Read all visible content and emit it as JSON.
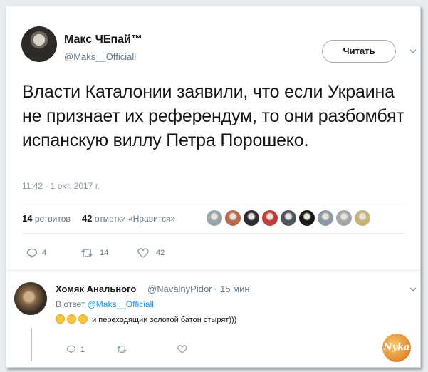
{
  "tweet": {
    "author": {
      "name": "Макс ЧЕпай™",
      "handle": "@Maks__Officiall"
    },
    "follow_label": "Читать",
    "text": "Власти Каталонии заявили, что если Украина не признает их референдум, то они разбомбят испанскую виллу Петра Порошеко.",
    "timestamp": "11:42 - 1 окт. 2017 г.",
    "stats": {
      "retweets_count": "14",
      "retweets_label": "ретвитов",
      "likes_count": "42",
      "likes_label": "отметки «Нравится»"
    },
    "likers": [
      "#9aa4ae",
      "#b86a4e",
      "#2c2f33",
      "#c43b3b",
      "#4a5560",
      "#1a1a1a",
      "#8c99a6",
      "#a3a7aa",
      "#c8b37a"
    ],
    "actions": {
      "replies": "4",
      "retweets": "14",
      "likes": "42"
    }
  },
  "reply": {
    "author": {
      "name": "Хомяк Анального",
      "handle": "@NavalnyPidor · 15 мин"
    },
    "reply_to_prefix": "В ответ",
    "reply_to_handle": "@Maks__Officiall",
    "text": "и переходящии золотой батон стырят)))",
    "actions": {
      "replies": "1"
    }
  },
  "watermark": "Nyka",
  "colors": {
    "accent": "#1b95e0",
    "muted": "#657786",
    "border": "#e6ecf0"
  }
}
